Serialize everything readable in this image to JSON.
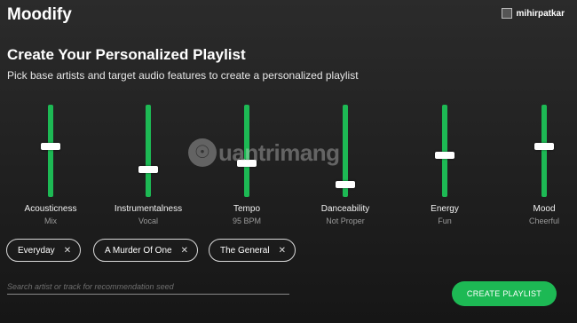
{
  "app": {
    "title": "Moodify"
  },
  "user": {
    "name": "mihirpatkar"
  },
  "header": {
    "title": "Create Your Personalized Playlist",
    "subtitle": "Pick base artists and target audio features to create a personalized playlist"
  },
  "sliders": [
    {
      "label": "Acousticness",
      "value_text": "Mix",
      "level": 0.55
    },
    {
      "label": "Instrumentalness",
      "value_text": "Vocal",
      "level": 0.3
    },
    {
      "label": "Tempo",
      "value_text": "95 BPM",
      "level": 0.37
    },
    {
      "label": "Danceability",
      "value_text": "Not Proper",
      "level": 0.13
    },
    {
      "label": "Energy",
      "value_text": "Fun",
      "level": 0.45
    },
    {
      "label": "Mood",
      "value_text": "Cheerful",
      "level": 0.55
    }
  ],
  "seeds": [
    {
      "label": "Everyday",
      "remove": "✕"
    },
    {
      "label": "A Murder Of One",
      "remove": "✕"
    },
    {
      "label": "The General",
      "remove": "✕"
    }
  ],
  "search": {
    "placeholder": "Search artist or track for recommendation seed"
  },
  "actions": {
    "create_label": "CREATE PLAYLIST"
  },
  "watermark": {
    "text": "uantrimang"
  },
  "colors": {
    "accent": "#1db954",
    "background": "#222222",
    "muted_text": "#9a9a9a"
  }
}
